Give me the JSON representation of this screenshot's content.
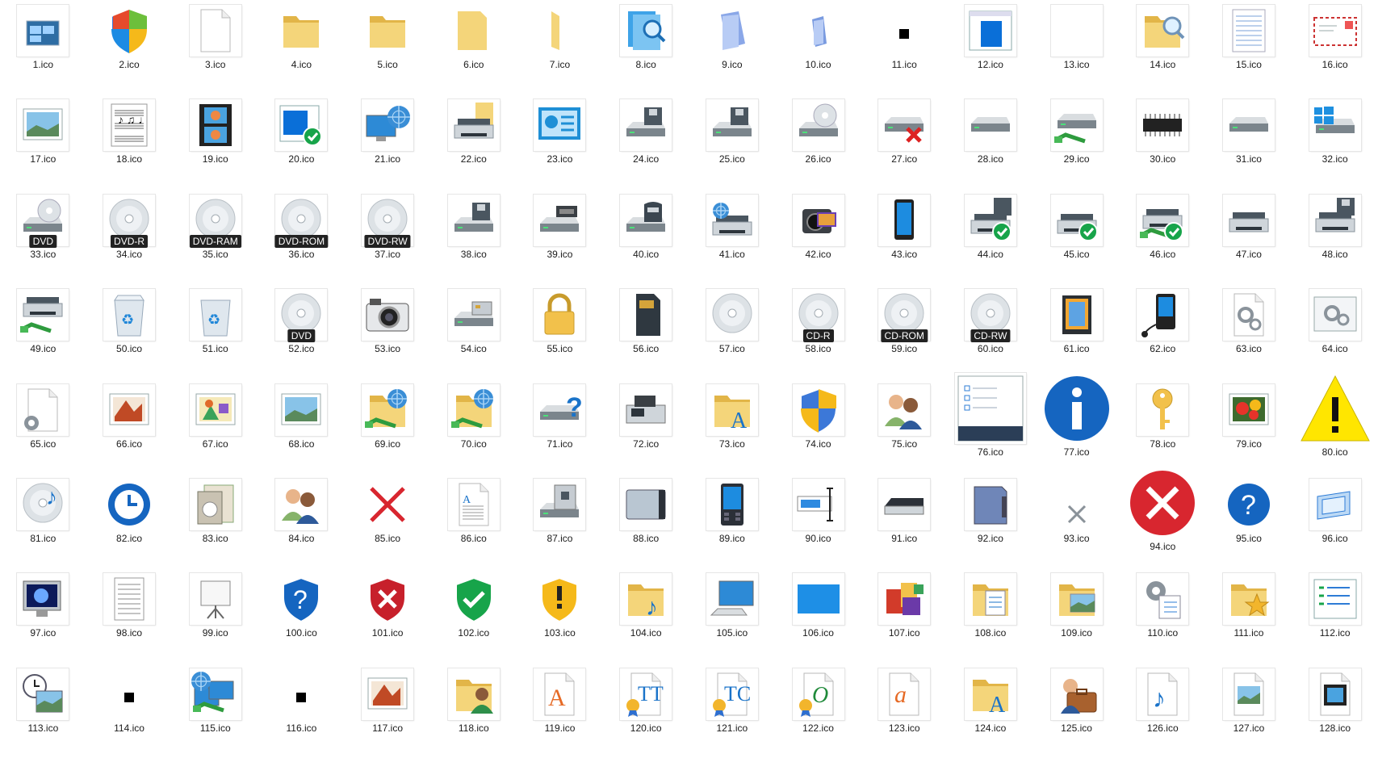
{
  "window": {
    "background": "#ffffff"
  },
  "colors": {
    "folder": "#f4d57a",
    "folder_dark": "#e2b548",
    "blue": "#1565c0",
    "green": "#17a44a",
    "red": "#d8262f",
    "gray": "#9aa3ab"
  },
  "icons": [
    {
      "label": "1.ico",
      "icon": "multiple-windows-icon",
      "kind": "windows"
    },
    {
      "label": "2.ico",
      "icon": "windows-shield-icon",
      "kind": "winshield"
    },
    {
      "label": "3.ico",
      "icon": "blank-document-icon",
      "kind": "doc"
    },
    {
      "label": "4.ico",
      "icon": "folder-icon",
      "kind": "folder"
    },
    {
      "label": "5.ico",
      "icon": "folder-icon",
      "kind": "folder"
    },
    {
      "label": "6.ico",
      "icon": "folder-icon",
      "kind": "folderback"
    },
    {
      "label": "7.ico",
      "icon": "folder-icon",
      "kind": "folderthin"
    },
    {
      "label": "8.ico",
      "icon": "search-files-icon",
      "kind": "searchblue"
    },
    {
      "label": "9.ico",
      "icon": "pages-icon",
      "kind": "pages"
    },
    {
      "label": "10.ico",
      "icon": "pages-icon",
      "kind": "pagessmall"
    },
    {
      "label": "11.ico",
      "icon": "small-black-square-icon",
      "kind": "blacksquare"
    },
    {
      "label": "12.ico",
      "icon": "application-window-icon",
      "kind": "appwindow"
    },
    {
      "label": "13.ico",
      "icon": "blank-icon",
      "kind": "blankbig"
    },
    {
      "label": "14.ico",
      "icon": "folder-search-icon",
      "kind": "foldersearch"
    },
    {
      "label": "15.ico",
      "icon": "lined-document-icon",
      "kind": "lineddoc"
    },
    {
      "label": "16.ico",
      "icon": "envelope-icon",
      "kind": "envelope"
    },
    {
      "label": "17.ico",
      "icon": "picture-frame-icon",
      "kind": "picframe"
    },
    {
      "label": "18.ico",
      "icon": "sheet-music-icon",
      "kind": "music"
    },
    {
      "label": "19.ico",
      "icon": "film-strip-icon",
      "kind": "film"
    },
    {
      "label": "20.ico",
      "icon": "window-check-icon",
      "kind": "windowcheck"
    },
    {
      "label": "21.ico",
      "icon": "network-computer-icon",
      "kind": "netpc"
    },
    {
      "label": "22.ico",
      "icon": "printer-folder-icon",
      "kind": "printerfolder"
    },
    {
      "label": "23.ico",
      "icon": "control-panel-icon",
      "kind": "controlpanel"
    },
    {
      "label": "24.ico",
      "icon": "floppy-drive-icon",
      "kind": "floppydrive"
    },
    {
      "label": "25.ico",
      "icon": "floppy-drive-icon",
      "kind": "floppydrive"
    },
    {
      "label": "26.ico",
      "icon": "cd-drive-icon",
      "kind": "cddrive"
    },
    {
      "label": "27.ico",
      "icon": "disconnected-drive-icon",
      "kind": "drivex"
    },
    {
      "label": "28.ico",
      "icon": "drive-icon",
      "kind": "drive"
    },
    {
      "label": "29.ico",
      "icon": "network-drive-icon",
      "kind": "netdrive"
    },
    {
      "label": "30.ico",
      "icon": "chip-icon",
      "kind": "chip"
    },
    {
      "label": "31.ico",
      "icon": "drive-icon",
      "kind": "drive"
    },
    {
      "label": "32.ico",
      "icon": "windows-drive-icon",
      "kind": "windrive"
    },
    {
      "label": "33.ico",
      "icon": "dvd-drive-icon",
      "kind": "dvddrive",
      "badge": "DVD"
    },
    {
      "label": "34.ico",
      "icon": "disc-icon",
      "kind": "disc",
      "badge": "DVD-R"
    },
    {
      "label": "35.ico",
      "icon": "disc-icon",
      "kind": "disc",
      "badge": "DVD-RAM"
    },
    {
      "label": "36.ico",
      "icon": "disc-icon",
      "kind": "disc",
      "badge": "DVD-ROM"
    },
    {
      "label": "37.ico",
      "icon": "disc-icon",
      "kind": "disc",
      "badge": "DVD-RW"
    },
    {
      "label": "38.ico",
      "icon": "floppy-drive-icon",
      "kind": "floppydrive"
    },
    {
      "label": "39.ico",
      "icon": "tape-drive-icon",
      "kind": "tapedrive"
    },
    {
      "label": "40.ico",
      "icon": "zip-drive-icon",
      "kind": "zipdrive"
    },
    {
      "label": "41.ico",
      "icon": "network-printer-icon",
      "kind": "netprinter"
    },
    {
      "label": "42.ico",
      "icon": "camcorder-icon",
      "kind": "camcorder"
    },
    {
      "label": "43.ico",
      "icon": "phone-icon",
      "kind": "phone"
    },
    {
      "label": "44.ico",
      "icon": "printer-check-icon",
      "kind": "printercheck"
    },
    {
      "label": "45.ico",
      "icon": "printer-check-icon",
      "kind": "printercheck2"
    },
    {
      "label": "46.ico",
      "icon": "network-printer-check-icon",
      "kind": "netprintercheck"
    },
    {
      "label": "47.ico",
      "icon": "printer-icon",
      "kind": "printer"
    },
    {
      "label": "48.ico",
      "icon": "printer-floppy-icon",
      "kind": "printerfloppy"
    },
    {
      "label": "49.ico",
      "icon": "network-printer-icon",
      "kind": "netprinter2"
    },
    {
      "label": "50.ico",
      "icon": "recycle-bin-full-icon",
      "kind": "recyclefull"
    },
    {
      "label": "51.ico",
      "icon": "recycle-bin-icon",
      "kind": "recycle"
    },
    {
      "label": "52.ico",
      "icon": "disc-icon",
      "kind": "disc",
      "badge": "DVD"
    },
    {
      "label": "53.ico",
      "icon": "camera-icon",
      "kind": "camera"
    },
    {
      "label": "54.ico",
      "icon": "card-reader-icon",
      "kind": "cardreader"
    },
    {
      "label": "55.ico",
      "icon": "padlock-icon",
      "kind": "lock"
    },
    {
      "label": "56.ico",
      "icon": "sd-card-icon",
      "kind": "sdcard"
    },
    {
      "label": "57.ico",
      "icon": "disc-icon",
      "kind": "discplain"
    },
    {
      "label": "58.ico",
      "icon": "disc-icon",
      "kind": "disc",
      "badge": "CD-R"
    },
    {
      "label": "59.ico",
      "icon": "disc-icon",
      "kind": "disc",
      "badge": "CD-ROM"
    },
    {
      "label": "60.ico",
      "icon": "disc-icon",
      "kind": "disc",
      "badge": "CD-RW"
    },
    {
      "label": "61.ico",
      "icon": "memory-card-icon",
      "kind": "memcard"
    },
    {
      "label": "62.ico",
      "icon": "media-player-icon",
      "kind": "mediaplayer"
    },
    {
      "label": "63.ico",
      "icon": "settings-document-icon",
      "kind": "gearsdoc"
    },
    {
      "label": "64.ico",
      "icon": "settings-window-icon",
      "kind": "gearswin"
    },
    {
      "label": "65.ico",
      "icon": "gear-document-icon",
      "kind": "geardoc"
    },
    {
      "label": "66.ico",
      "icon": "paint-image-icon",
      "kind": "paint"
    },
    {
      "label": "67.ico",
      "icon": "shapes-image-icon",
      "kind": "shapes"
    },
    {
      "label": "68.ico",
      "icon": "landscape-image-icon",
      "kind": "landscape"
    },
    {
      "label": "69.ico",
      "icon": "network-folder-icon",
      "kind": "netfolder"
    },
    {
      "label": "70.ico",
      "icon": "network-folder-icon",
      "kind": "netfolder2"
    },
    {
      "label": "71.ico",
      "icon": "unknown-drive-icon",
      "kind": "drivequestion"
    },
    {
      "label": "72.ico",
      "icon": "fax-icon",
      "kind": "fax"
    },
    {
      "label": "73.ico",
      "icon": "font-folder-icon",
      "kind": "fontfolder"
    },
    {
      "label": "74.ico",
      "icon": "uac-shield-icon",
      "kind": "uacshield"
    },
    {
      "label": "75.ico",
      "icon": "users-icon",
      "kind": "users"
    },
    {
      "label": "76.ico",
      "icon": "checklist-window-icon",
      "kind": "checklistwin",
      "big": true
    },
    {
      "label": "77.ico",
      "icon": "info-icon",
      "kind": "info",
      "big": true
    },
    {
      "label": "78.ico",
      "icon": "key-icon",
      "kind": "key"
    },
    {
      "label": "79.ico",
      "icon": "flowers-image-icon",
      "kind": "flowers"
    },
    {
      "label": "80.ico",
      "icon": "warning-icon",
      "kind": "warning",
      "big": true
    },
    {
      "label": "81.ico",
      "icon": "music-disc-icon",
      "kind": "musicdisc"
    },
    {
      "label": "82.ico",
      "icon": "time-restore-icon",
      "kind": "timerestore"
    },
    {
      "label": "83.ico",
      "icon": "media-library-icon",
      "kind": "medialib"
    },
    {
      "label": "84.ico",
      "icon": "users-icon",
      "kind": "users"
    },
    {
      "label": "85.ico",
      "icon": "delete-icon",
      "kind": "redx"
    },
    {
      "label": "86.ico",
      "icon": "text-document-icon",
      "kind": "textdoc"
    },
    {
      "label": "87.ico",
      "icon": "media-drive-icon",
      "kind": "mediadrive"
    },
    {
      "label": "88.ico",
      "icon": "external-drive-icon",
      "kind": "extdrive"
    },
    {
      "label": "89.ico",
      "icon": "pda-icon",
      "kind": "pda"
    },
    {
      "label": "90.ico",
      "icon": "text-field-icon",
      "kind": "textfield"
    },
    {
      "label": "91.ico",
      "icon": "scanner-icon",
      "kind": "scanner"
    },
    {
      "label": "92.ico",
      "icon": "removable-device-icon",
      "kind": "removable"
    },
    {
      "label": "93.ico",
      "icon": "small-x-icon",
      "kind": "smallx"
    },
    {
      "label": "94.ico",
      "icon": "error-icon",
      "kind": "error",
      "big": true
    },
    {
      "label": "95.ico",
      "icon": "help-icon",
      "kind": "help"
    },
    {
      "label": "96.ico",
      "icon": "window-transition-icon",
      "kind": "wintrans"
    },
    {
      "label": "97.ico",
      "icon": "screensaver-monitor-icon",
      "kind": "screensaver"
    },
    {
      "label": "98.ico",
      "icon": "text-document-icon",
      "kind": "plaintext"
    },
    {
      "label": "99.ico",
      "icon": "projector-screen-icon",
      "kind": "projector"
    },
    {
      "label": "100.ico",
      "icon": "shield-question-icon",
      "kind": "shieldq"
    },
    {
      "label": "101.ico",
      "icon": "shield-x-icon",
      "kind": "shieldx"
    },
    {
      "label": "102.ico",
      "icon": "shield-check-icon",
      "kind": "shieldcheck"
    },
    {
      "label": "103.ico",
      "icon": "shield-warning-icon",
      "kind": "shieldwarn"
    },
    {
      "label": "104.ico",
      "icon": "music-folder-icon",
      "kind": "musicfolder"
    },
    {
      "label": "105.ico",
      "icon": "desktop-computer-icon",
      "kind": "desktop"
    },
    {
      "label": "106.ico",
      "icon": "desktop-background-icon",
      "kind": "desktopbg"
    },
    {
      "label": "107.ico",
      "icon": "programs-icon",
      "kind": "programs"
    },
    {
      "label": "108.ico",
      "icon": "documents-folder-icon",
      "kind": "docfolder"
    },
    {
      "label": "109.ico",
      "icon": "pictures-folder-icon",
      "kind": "picfolder"
    },
    {
      "label": "110.ico",
      "icon": "task-settings-icon",
      "kind": "tasksettings"
    },
    {
      "label": "111.ico",
      "icon": "favorites-folder-icon",
      "kind": "favfolder"
    },
    {
      "label": "112.ico",
      "icon": "list-window-icon",
      "kind": "listwin"
    },
    {
      "label": "113.ico",
      "icon": "clock-picture-icon",
      "kind": "clockpic"
    },
    {
      "label": "114.ico",
      "icon": "small-black-square-icon",
      "kind": "blacksquare"
    },
    {
      "label": "115.ico",
      "icon": "network-computers-icon",
      "kind": "netpcs"
    },
    {
      "label": "116.ico",
      "icon": "small-black-square-icon",
      "kind": "blacksquare"
    },
    {
      "label": "117.ico",
      "icon": "paint-image-icon",
      "kind": "paint"
    },
    {
      "label": "118.ico",
      "icon": "user-folder-icon",
      "kind": "userfolder"
    },
    {
      "label": "119.ico",
      "icon": "font-file-icon",
      "kind": "fontA"
    },
    {
      "label": "120.ico",
      "icon": "truetype-font-icon",
      "kind": "fontTT"
    },
    {
      "label": "121.ico",
      "icon": "truetype-collection-icon",
      "kind": "fontTC"
    },
    {
      "label": "122.ico",
      "icon": "opentype-font-icon",
      "kind": "fontO"
    },
    {
      "label": "123.ico",
      "icon": "font-a-icon",
      "kind": "fonta"
    },
    {
      "label": "124.ico",
      "icon": "font-folder-icon",
      "kind": "fontfolder"
    },
    {
      "label": "125.ico",
      "icon": "user-briefcase-icon",
      "kind": "briefcase"
    },
    {
      "label": "126.ico",
      "icon": "music-note-icon",
      "kind": "musicnote"
    },
    {
      "label": "127.ico",
      "icon": "image-document-icon",
      "kind": "imagedoc"
    },
    {
      "label": "128.ico",
      "icon": "video-document-icon",
      "kind": "videodoc"
    }
  ]
}
